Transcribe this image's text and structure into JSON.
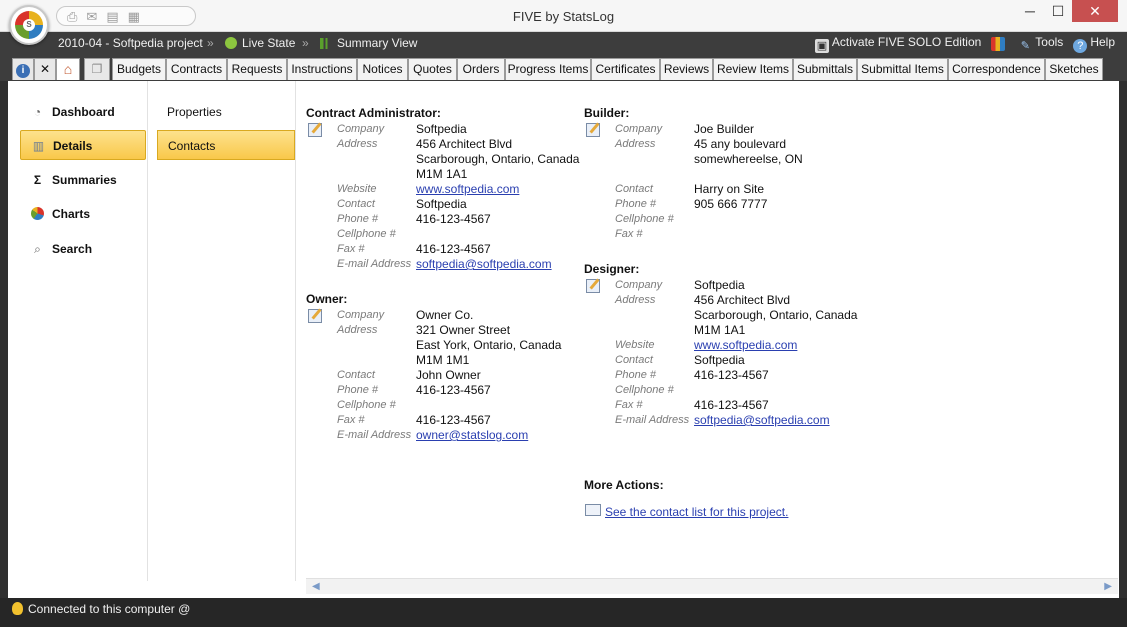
{
  "window": {
    "title": "FIVE by StatsLog",
    "min": "─",
    "max": "☐",
    "close": "✕"
  },
  "breadcrumb": {
    "project": "2010-04 - Softpedia project",
    "sep": "»",
    "live": "Live State",
    "view": "Summary View"
  },
  "actions": {
    "activate": "Activate FIVE SOLO Edition",
    "tools": "Tools",
    "help": "Help"
  },
  "tabs": [
    "Budgets",
    "Contracts",
    "Requests",
    "Instructions",
    "Notices",
    "Quotes",
    "Orders",
    "Progress Items",
    "Certificates",
    "Reviews",
    "Review Items",
    "Submittals",
    "Submittal Items",
    "Correspondence",
    "Sketches"
  ],
  "nav": {
    "items": [
      "Dashboard",
      "Details",
      "Summaries",
      "Charts",
      "Search"
    ],
    "active": "Details"
  },
  "subnav": {
    "items": [
      "Properties",
      "Contacts"
    ],
    "active": "Contacts"
  },
  "labels": {
    "company": "Company",
    "address": "Address",
    "website": "Website",
    "contact": "Contact",
    "phone": "Phone #",
    "cell": "Cellphone #",
    "fax": "Fax #",
    "email": "E-mail Address"
  },
  "admin": {
    "title": "Contract Administrator:",
    "company": "Softpedia",
    "address": [
      "456 Architect Blvd",
      "Scarborough, Ontario, Canada",
      "M1M 1A1"
    ],
    "website": "www.softpedia.com",
    "contact": "Softpedia",
    "phone": "416-123-4567",
    "fax": "416-123-4567",
    "email": "softpedia@softpedia.com"
  },
  "owner": {
    "title": "Owner:",
    "company": "Owner Co.",
    "address": [
      "321 Owner Street",
      "East York, Ontario, Canada",
      "M1M 1M1"
    ],
    "contact": "John Owner",
    "phone": "416-123-4567",
    "fax": "416-123-4567",
    "email": "owner@statslog.com"
  },
  "builder": {
    "title": "Builder:",
    "company": "Joe Builder",
    "address": [
      "45 any boulevard",
      "somewhereelse, ON"
    ],
    "contact": "Harry on Site",
    "phone": "905 666 7777"
  },
  "designer": {
    "title": "Designer:",
    "company": "Softpedia",
    "address": [
      "456 Architect Blvd",
      "Scarborough, Ontario, Canada",
      "M1M 1A1"
    ],
    "website": "www.softpedia.com",
    "contact": "Softpedia",
    "phone": "416-123-4567",
    "fax": "416-123-4567",
    "email": "softpedia@softpedia.com"
  },
  "more": {
    "title": "More Actions:",
    "link": "See the contact list for this project."
  },
  "status": {
    "text": "Connected to this computer @"
  }
}
